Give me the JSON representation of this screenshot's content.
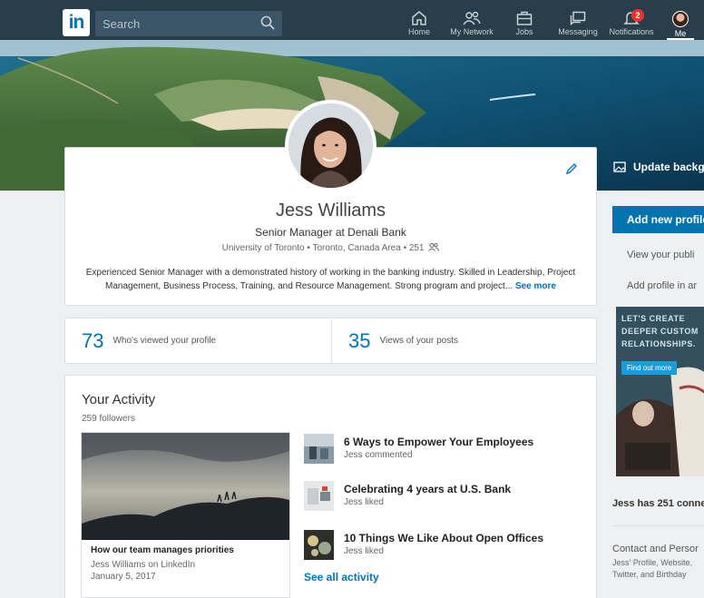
{
  "nav": {
    "logo": "in",
    "search_placeholder": "Search",
    "items": [
      {
        "label": "Home",
        "icon": "home-icon"
      },
      {
        "label": "My Network",
        "icon": "network-icon"
      },
      {
        "label": "Jobs",
        "icon": "briefcase-icon"
      },
      {
        "label": "Messaging",
        "icon": "messaging-icon"
      },
      {
        "label": "Notifications",
        "icon": "bell-icon",
        "badge": "2"
      },
      {
        "label": "Me",
        "icon": "avatar"
      }
    ]
  },
  "profile": {
    "name": "Jess Williams",
    "headline": "Senior Manager at Denali Bank",
    "meta": "University of Toronto • Toronto, Canada Area • 251",
    "summary": "Experienced Senior Manager with a demonstrated history of working in the banking industry. Skilled in Leadership, Project Management, Business Process, Training, and Resource Management. Strong program and project...",
    "see_more": "See more"
  },
  "stats": [
    {
      "value": "73",
      "label": "Who's viewed your profile"
    },
    {
      "value": "35",
      "label": "Views of your posts"
    }
  ],
  "activity": {
    "title": "Your Activity",
    "followers": "259 followers",
    "featured": {
      "title": "How our team manages priorities",
      "source": "Jess Williams on LinkedIn",
      "date": "January 5, 2017"
    },
    "items": [
      {
        "title": "6 Ways to Empower Your Employees",
        "sub": "Jess commented"
      },
      {
        "title": "Celebrating 4 years at U.S. Bank",
        "sub": "Jess liked"
      },
      {
        "title": "10 Things We Like About Open Offices",
        "sub": "Jess liked"
      }
    ],
    "see_all": "See all activity"
  },
  "rail": {
    "update_background": "Update backgr",
    "add_profile_btn": "Add new profile",
    "view_public": "View your publi",
    "add_profile_in": "Add profile in ar",
    "ad": {
      "line1": "LET'S CREATE",
      "line2": "DEEPER CUSTOM",
      "line3": "RELATIONSHIPS.",
      "button": "Find out more"
    },
    "connections": "Jess has 251 conne",
    "contact_title": "Contact and Persor",
    "contact_line1": "Jess' Profile, Website,",
    "contact_line2": "Twitter, and Birthday"
  },
  "colors": {
    "nav_bg": "#283e4a",
    "brand_blue": "#0073b1",
    "page_bg": "#eef0f2"
  }
}
